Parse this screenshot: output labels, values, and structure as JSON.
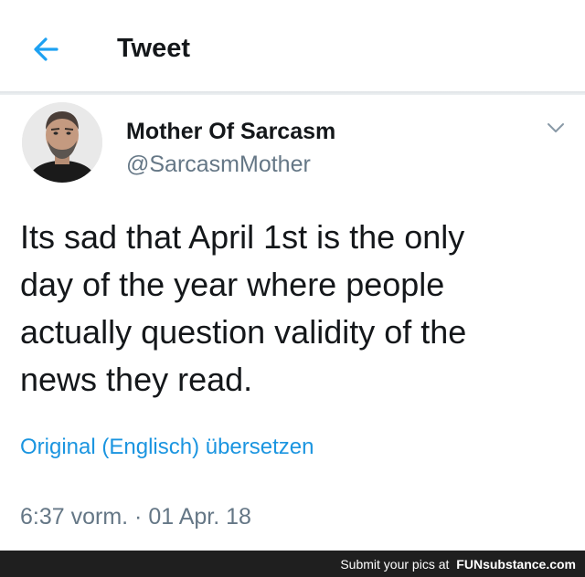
{
  "header": {
    "back_icon": "arrow-left-icon",
    "title": "Tweet"
  },
  "colors": {
    "accent": "#1da1f2",
    "link": "#1b95e0",
    "secondary_text": "#657786",
    "footer_bg": "#1f1f1f"
  },
  "tweet": {
    "author_name": "Mother Of Sarcasm",
    "handle": "@SarcasmMother",
    "text": "Its sad that April 1st is the only\nday of the year where people\nactually question validity of the\nnews they read.",
    "translate_label": "Original (Englisch) übersetzen",
    "timestamp": "6:37 vorm. · 01 Apr. 18",
    "menu_icon": "chevron-down-icon"
  },
  "footer": {
    "caption": "Submit your pics at",
    "brand": "FUNsubstance.com"
  }
}
